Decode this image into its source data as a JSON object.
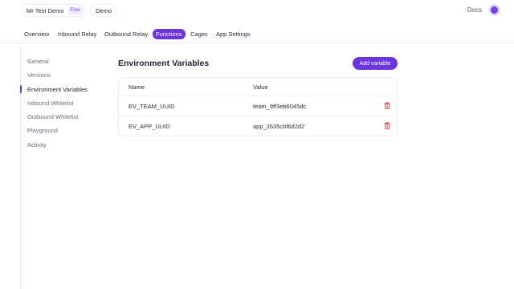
{
  "header": {
    "team_name": "Mr Test Demo",
    "plan_badge": "Free",
    "app_name": "Demo",
    "docs_link": "Docs",
    "avatar_icon": "avatar-icon",
    "accent_color": "#6b35d9"
  },
  "tabs": [
    {
      "label": "Overview",
      "active": false
    },
    {
      "label": "Inbound Relay",
      "active": false
    },
    {
      "label": "Outbound Relay",
      "active": false
    },
    {
      "label": "Functions",
      "active": true
    },
    {
      "label": "Cages",
      "active": false
    },
    {
      "label": "App Settings",
      "active": false
    }
  ],
  "sidebar": {
    "items": [
      {
        "label": "General",
        "active": false
      },
      {
        "label": "Versions",
        "active": false
      },
      {
        "label": "Environment Variables",
        "active": true
      },
      {
        "label": "Inbound Whitelist",
        "active": false
      },
      {
        "label": "Outbound Whitelist",
        "active": false
      },
      {
        "label": "Playground",
        "active": false
      },
      {
        "label": "Activity",
        "active": false
      }
    ]
  },
  "main": {
    "title": "Environment Variables",
    "add_button": "Add variable",
    "columns": [
      "Name",
      "Value"
    ],
    "rows": [
      {
        "name": "EV_TEAM_UUID",
        "value": "team_9ff3eb6045dc",
        "delete_icon": "trash-icon"
      },
      {
        "name": "EV_APP_UUID",
        "value": "app_2635cbf6d2d2",
        "delete_icon": "trash-icon"
      }
    ],
    "delete_color": "#e5484d"
  }
}
